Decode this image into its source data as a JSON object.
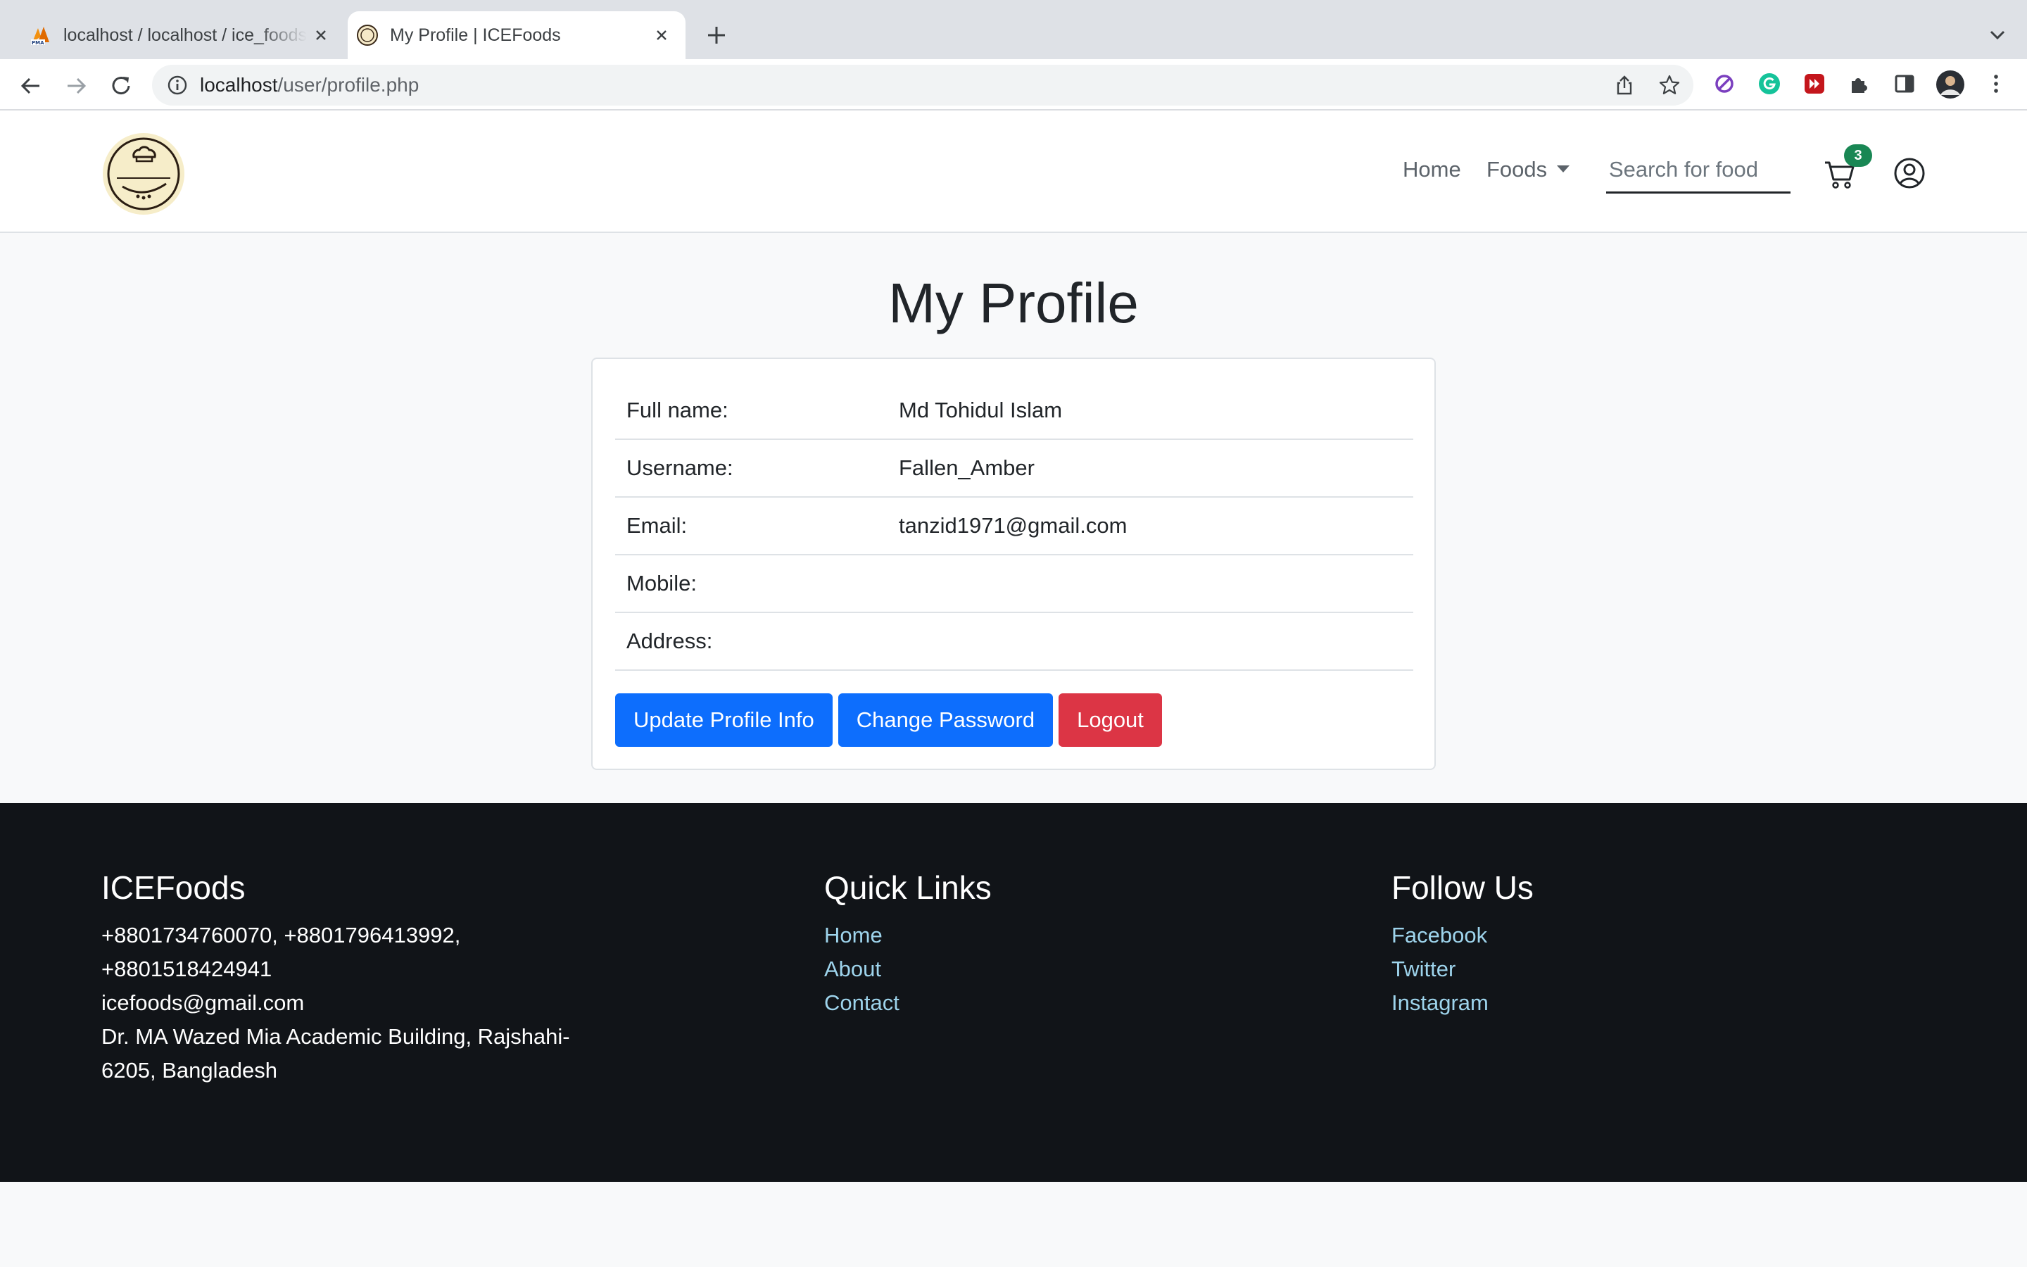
{
  "browser": {
    "tabs": [
      {
        "title": "localhost / localhost / ice_foods",
        "active": false
      },
      {
        "title": "My Profile | ICEFoods",
        "active": true
      }
    ],
    "url_host": "localhost",
    "url_path": "/user/profile.php"
  },
  "navbar": {
    "home_label": "Home",
    "foods_label": "Foods",
    "search_placeholder": "Search for food",
    "cart_count": "3"
  },
  "page": {
    "title": "My Profile"
  },
  "profile": {
    "rows": [
      {
        "label": "Full name:",
        "value": "Md Tohidul Islam"
      },
      {
        "label": "Username:",
        "value": "Fallen_Amber"
      },
      {
        "label": "Email:",
        "value": "tanzid1971@gmail.com"
      },
      {
        "label": "Mobile:",
        "value": ""
      },
      {
        "label": "Address:",
        "value": ""
      }
    ],
    "buttons": {
      "update": "Update Profile Info",
      "password": "Change Password",
      "logout": "Logout"
    }
  },
  "footer": {
    "brand": "ICEFoods",
    "phone_line1": "+8801734760070, +8801796413992,",
    "phone_line2": "+8801518424941",
    "email": "icefoods@gmail.com",
    "address_line1": "Dr. MA Wazed Mia Academic Building, Rajshahi-",
    "address_line2": "6205, Bangladesh",
    "quick_links_title": "Quick Links",
    "quick_links": [
      "Home",
      "About",
      "Contact"
    ],
    "follow_title": "Follow Us",
    "follow_links": [
      "Facebook",
      "Twitter",
      "Instagram"
    ]
  },
  "colors": {
    "primary": "#0d6efd",
    "danger": "#dc3545",
    "badge": "#198754",
    "footer_bg": "#111418",
    "footer_link": "#9ed4ec"
  }
}
